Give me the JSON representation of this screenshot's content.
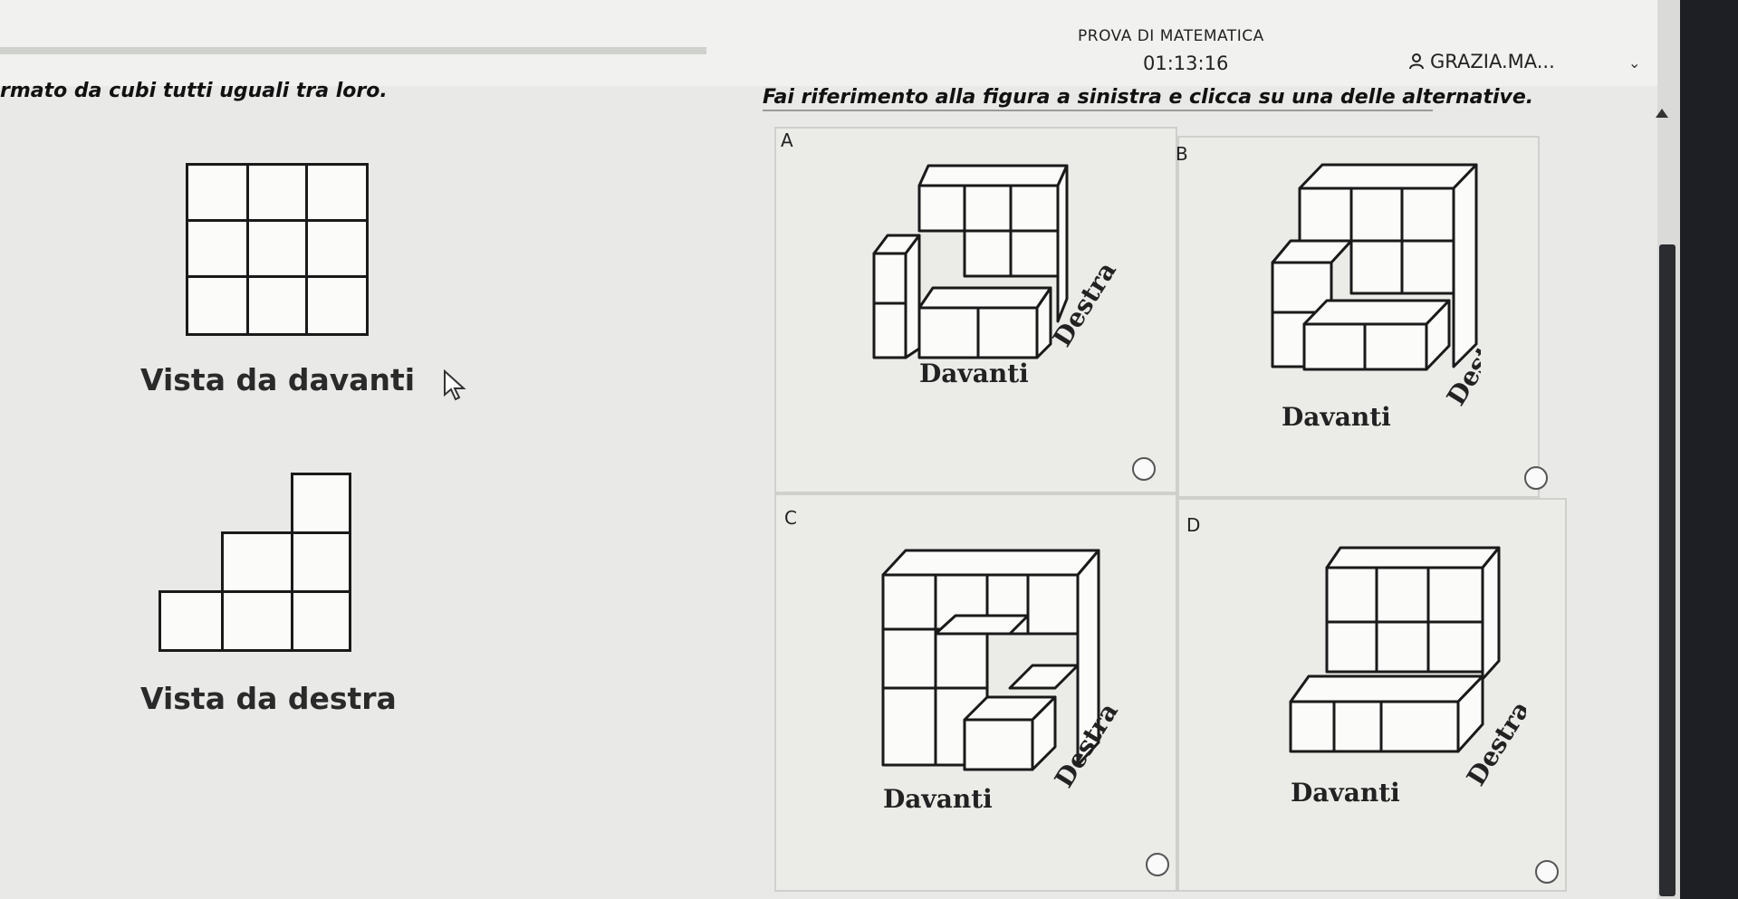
{
  "header": {
    "exam_title": "PROVA DI MATEMATICA",
    "timer": "01:13:16",
    "user_name": "GRAZIA.MA..."
  },
  "question": {
    "text": "rmato da cubi tutti uguali tra loro.",
    "instruction": "Fai riferimento alla figura a sinistra e clicca su una delle alternative."
  },
  "views": {
    "front_label": "Vista da davanti",
    "right_label": "Vista da destra"
  },
  "options": [
    {
      "letter": "A",
      "front": "Davanti",
      "right": "Destra"
    },
    {
      "letter": "B",
      "front": "Davanti",
      "right": "Destra"
    },
    {
      "letter": "C",
      "front": "Davanti",
      "right": "Destra"
    },
    {
      "letter": "D",
      "front": "Davanti",
      "right": "Destra"
    }
  ],
  "icons": [
    "user-icon",
    "chevron-down-icon",
    "cursor-icon",
    "scroll-up-icon"
  ]
}
